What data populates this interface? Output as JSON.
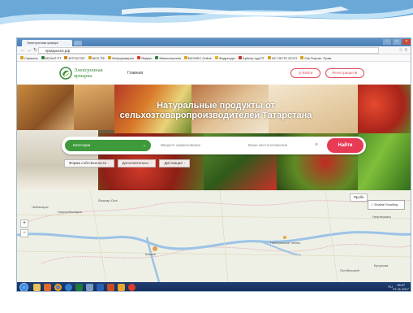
{
  "browser": {
    "tab_title": "Электронная ярмарк",
    "url": "ярмарка16.рф",
    "bookmarks": [
      "Сервисы",
      "МСХиП РТ",
      "АГРОСТАТ",
      "МСХ РФ",
      "Информацион",
      "Яндекс",
      "Министерства",
      "БИЗНЕС Online",
      "Федресурс",
      "Арбитр.суд РТ",
      "ИС ПК ПП ОСУП",
      "Оф.Портал. Прав."
    ]
  },
  "site": {
    "logo_line1": "Электронная",
    "logo_line2": "ярмарка",
    "nav_home": "Главная",
    "login_label": "Войти",
    "register_label": "Регистрация"
  },
  "hero": {
    "title_line1": "Натуральные продукты от",
    "title_line2": "сельхозтоваропроизводителей Татарстана",
    "category_label": "Категории",
    "name_placeholder": "Введите наименование",
    "location_placeholder": "Ваше местоположение",
    "find_label": "Найти",
    "filters": [
      "Форма собственности",
      "Дополнительно",
      "Дистанция"
    ]
  },
  "map": {
    "layer_label": "Пробк",
    "tooltip": "Enable Scrolling",
    "cities": [
      "Чебоксары",
      "Новочебоксарск",
      "Йошкар-Ола",
      "Казань",
      "Набережные Челны",
      "Нефтекамск",
      "Бугульма",
      "Октябрьский"
    ]
  },
  "taskbar": {
    "time": "18:27",
    "date": "07.11.2017",
    "lang": "RU"
  },
  "colors": {
    "accent_green": "#3f9a3c",
    "accent_red": "#e73a55",
    "logo_green": "#3c8b3c"
  }
}
